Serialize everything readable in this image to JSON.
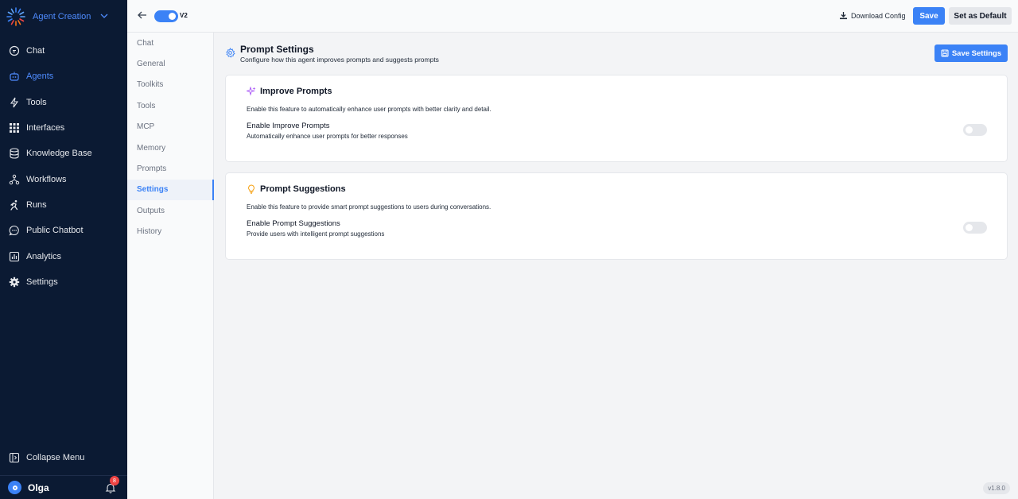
{
  "brand": {
    "name": "Agent Creation"
  },
  "sidebar": {
    "items": [
      {
        "label": "Chat"
      },
      {
        "label": "Agents"
      },
      {
        "label": "Tools"
      },
      {
        "label": "Interfaces"
      },
      {
        "label": "Knowledge Base"
      },
      {
        "label": "Workflows"
      },
      {
        "label": "Runs"
      },
      {
        "label": "Public Chatbot"
      },
      {
        "label": "Analytics"
      },
      {
        "label": "Settings"
      }
    ],
    "active": "Agents",
    "collapse_label": "Collapse Menu",
    "user": {
      "name": "Olga",
      "notifications": "8"
    }
  },
  "topbar": {
    "version_label": "V2",
    "download_label": "Download Config",
    "save_label": "Save",
    "default_label": "Set as Default"
  },
  "subnav": {
    "items": [
      "Chat",
      "General",
      "Toolkits",
      "Tools",
      "MCP",
      "Memory",
      "Prompts",
      "Settings",
      "Outputs",
      "History"
    ],
    "active": "Settings"
  },
  "main": {
    "title": "Prompt Settings",
    "subtitle": "Configure how this agent improves prompts and suggests prompts",
    "save_settings_label": "Save Settings",
    "cards": [
      {
        "title": "Improve Prompts",
        "description": "Enable this feature to automatically enhance user prompts with better clarity and detail.",
        "option_label": "Enable Improve Prompts",
        "option_sub": "Automatically enhance user prompts for better responses",
        "enabled": false
      },
      {
        "title": "Prompt Suggestions",
        "description": "Enable this feature to provide smart prompt suggestions to users during conversations.",
        "option_label": "Enable Prompt Suggestions",
        "option_sub": "Provide users with intelligent prompt suggestions",
        "enabled": false
      }
    ]
  },
  "version": "v1.8.0",
  "colors": {
    "accent": "#3b82f6",
    "sidebar_bg": "#0b1a33",
    "sparkle": "#a855f7",
    "bulb": "#f59e0b"
  }
}
